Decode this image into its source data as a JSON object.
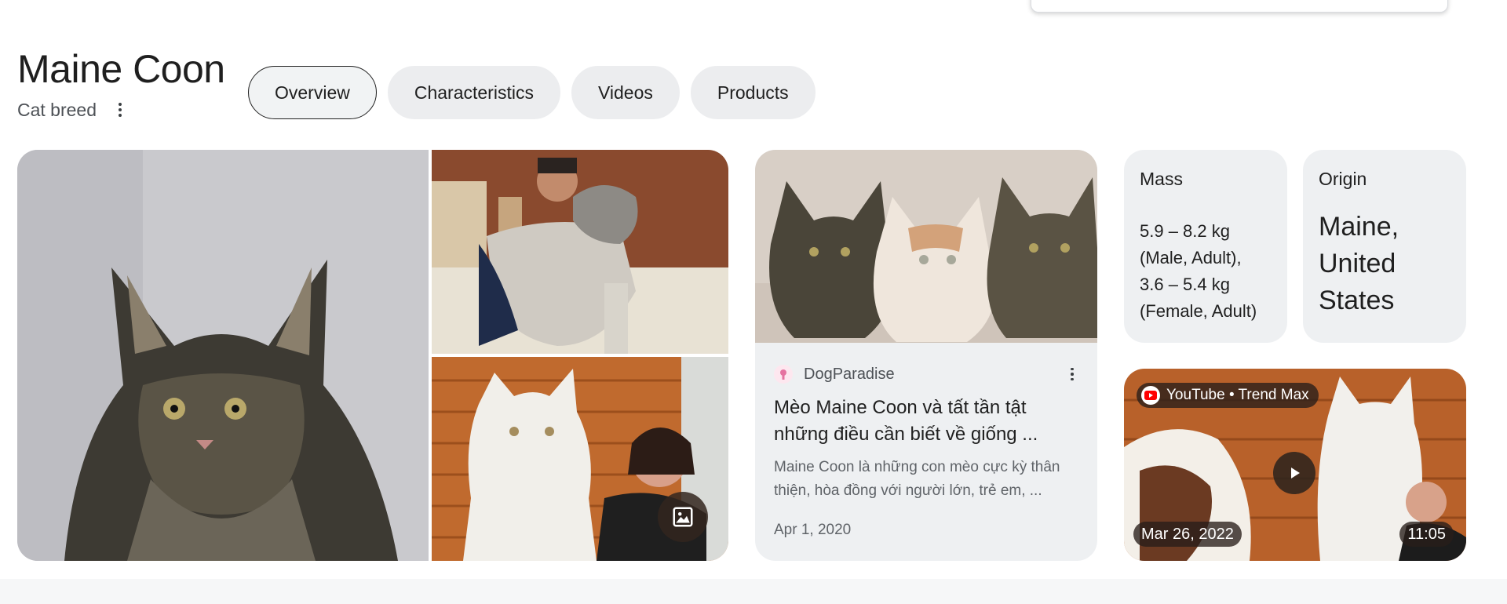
{
  "entity": {
    "title": "Maine Coon",
    "subtitle": "Cat breed"
  },
  "tabs": [
    {
      "label": "Overview",
      "active": true
    },
    {
      "label": "Characteristics",
      "active": false
    },
    {
      "label": "Videos",
      "active": false
    },
    {
      "label": "Products",
      "active": false
    }
  ],
  "gallery": {
    "images_button_icon": "image-icon"
  },
  "article": {
    "source": "DogParadise",
    "title": "Mèo Maine Coon và tất tần tật những điều cần biết về giống ...",
    "snippet": "Maine Coon là những con mèo cực kỳ thân thiện, hòa đồng với người lớn, trẻ em, ...",
    "date": "Apr 1, 2020"
  },
  "facts": [
    {
      "label": "Mass",
      "value": "5.9 – 8.2 kg\n(Male, Adult),\n3.6 – 5.4 kg\n(Female, Adult)"
    },
    {
      "label": "Origin",
      "value": "Maine,\nUnited\nStates"
    }
  ],
  "video": {
    "source": "YouTube • Trend Max",
    "date": "Mar 26, 2022",
    "duration": "11:05"
  },
  "colors": {
    "chip_bg": "#ecedef",
    "card_bg": "#eef0f2",
    "text": "#1f1f1f",
    "secondary_text": "#5f6368",
    "youtube_red": "#ff0000"
  }
}
